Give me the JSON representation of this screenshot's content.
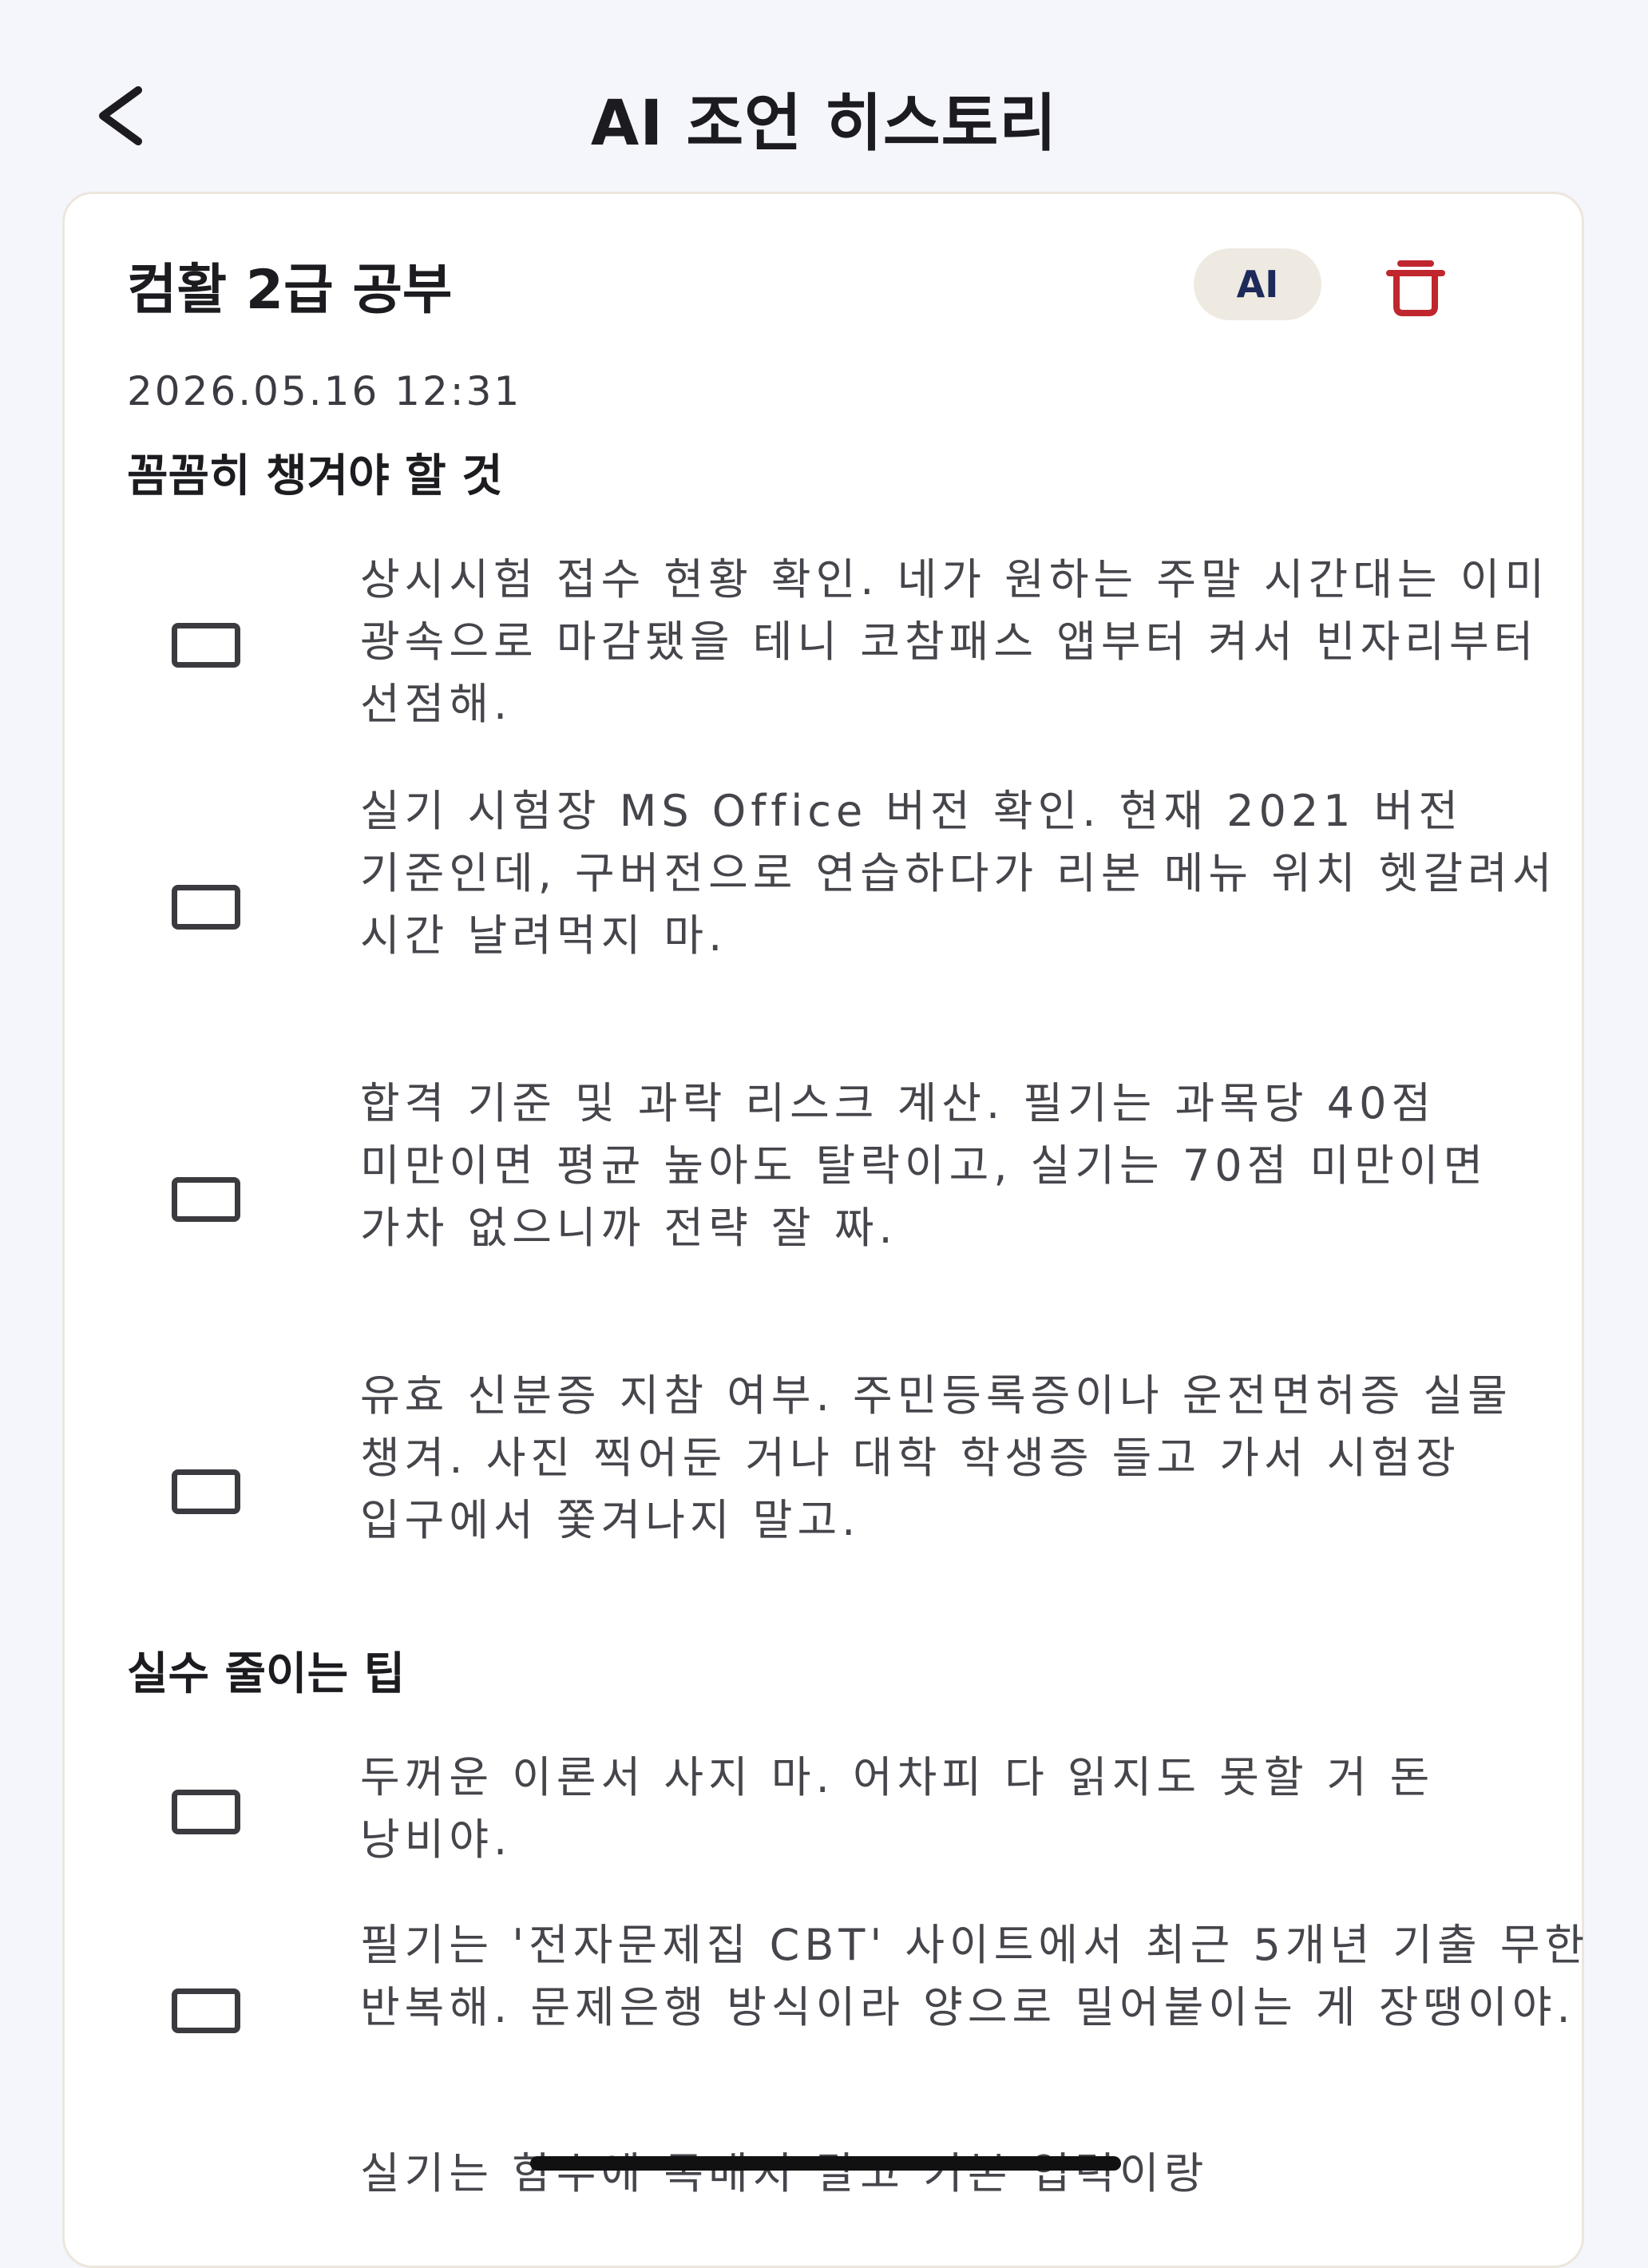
{
  "header": {
    "title": "AI 조언 히스토리",
    "back_icon": "chevron-left-icon"
  },
  "card": {
    "title": "컴활 2급 공부",
    "badge": "AI",
    "delete_icon": "trash-icon",
    "date": "2026.05.16 12:31",
    "sections": [
      {
        "title": "꼼꼼히 챙겨야 할 것",
        "items": [
          {
            "checked": false,
            "text": "상시시험 접수 현황 확인. 네가 원하는 주말 시간대는 이미 광속으로 마감됐을 테니 코참패스 앱부터 켜서 빈자리부터 선점해."
          },
          {
            "checked": false,
            "text": "실기 시험장 MS Office 버전 확인. 현재 2021 버전 기준인데, 구버전으로 연습하다가 리본 메뉴 위치 헷갈려서 시간 날려먹지 마."
          },
          {
            "checked": false,
            "text": "합격 기준 및 과락 리스크 계산. 필기는 과목당 40점 미만이면 평균 높아도 탈락이고, 실기는 70점 미만이면 가차 없으니까 전략 잘 짜."
          },
          {
            "checked": false,
            "text": "유효 신분증 지참 여부. 주민등록증이나 운전면허증 실물 챙겨. 사진 찍어둔 거나 대학 학생증 들고 가서 시험장 입구에서 쫓겨나지 말고."
          }
        ]
      },
      {
        "title": "실수 줄이는 팁",
        "items": [
          {
            "checked": false,
            "text": "두꺼운 이론서 사지 마. 어차피 다 읽지도 못할 거 돈 낭비야."
          },
          {
            "checked": false,
            "text": "필기는 '전자문제집 CBT' 사이트에서 최근 5개년 기출 무한 반복해. 문제은행 방식이라 양으로 밀어붙이는 게 장땡이야."
          },
          {
            "checked": false,
            "text": "실기는 함수에 목매지 말고 기본 입력이랑"
          }
        ]
      }
    ]
  },
  "colors": {
    "background": "#f5f6fb",
    "card": "#ffffff",
    "badge_bg": "#eeeae2",
    "badge_text": "#1d2a5a",
    "delete": "#c0262d"
  }
}
